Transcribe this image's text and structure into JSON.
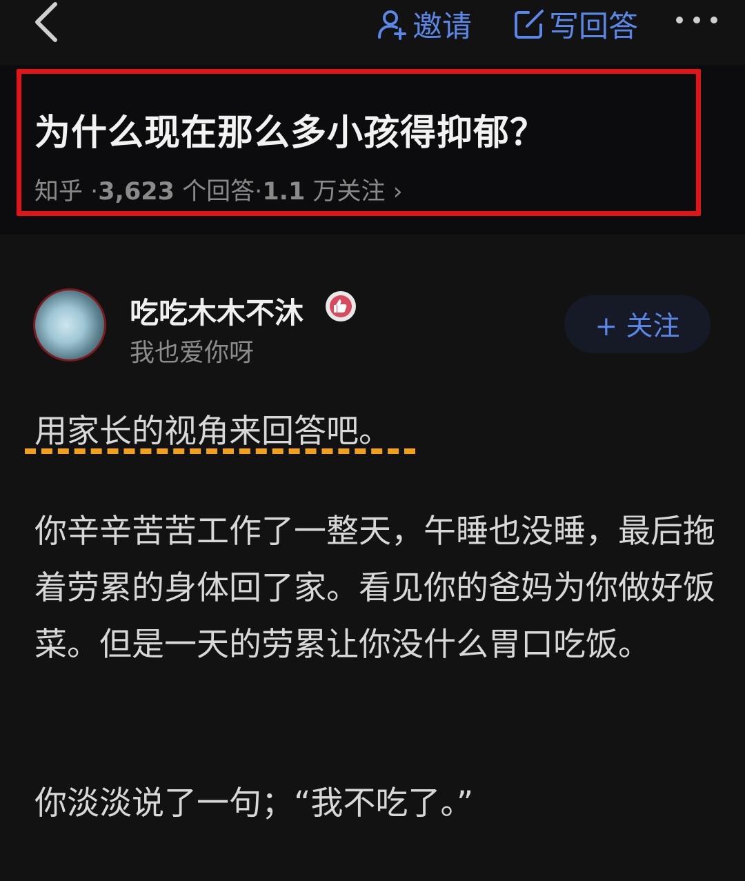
{
  "topbar": {
    "invite_label": "邀请",
    "write_answer_label": "写回答"
  },
  "question": {
    "title": "为什么现在那么多小孩得抑郁？",
    "source": "知乎",
    "answers_count": "3,623",
    "answers_label": "个回答",
    "followers_count": "1.1",
    "followers_label": "万关注",
    "sep": "·"
  },
  "author": {
    "name": "吃吃木木不沐",
    "bio": "我也爱你呀",
    "follow_label": "+ 关注"
  },
  "answer": {
    "para1": "用家长的视角来回答吧。",
    "para2": "你辛辛苦苦工作了一整天，午睡也没睡，最后拖着劳累的身体回了家。看见你的爸妈为你做好饭菜。但是一天的劳累让你没什么胃口吃饭。",
    "para3": "你淡淡说了一句；“我不吃了。”"
  },
  "colors": {
    "accent": "#5b88e8",
    "highlight_box": "#e1141a",
    "underline": "#f2a01a"
  }
}
